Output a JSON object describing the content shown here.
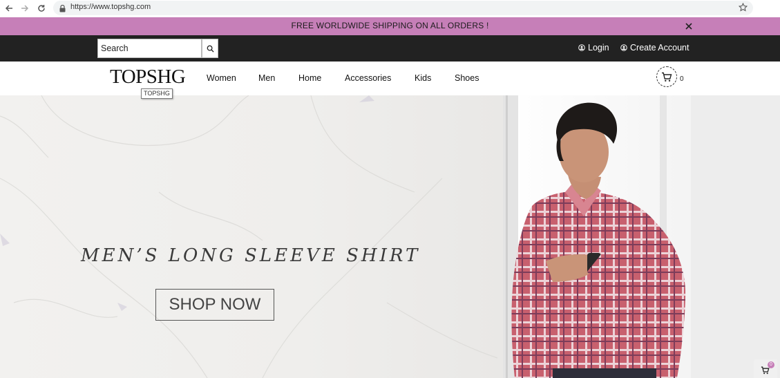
{
  "browser": {
    "url": "https://www.topshg.com",
    "back_icon": "arrow-left-icon",
    "forward_icon": "arrow-right-icon",
    "reload_icon": "reload-icon",
    "lock_icon": "lock-icon",
    "bookmark_icon": "star-icon"
  },
  "announcement": {
    "text": "FREE WORLDWIDE SHIPPING ON ALL ORDERS !",
    "close_icon": "close-icon",
    "background": "#c67fb8"
  },
  "topbar": {
    "search_placeholder": "Search",
    "search_icon": "search-icon",
    "login_label": "Login",
    "create_account_label": "Create Account",
    "background": "#222222"
  },
  "header": {
    "logo": "TOPSHG",
    "logo_tooltip": "TOPSHG",
    "nav": [
      "Women",
      "Men",
      "Home",
      "Accessories",
      "Kids",
      "Shoes"
    ],
    "cart_count": "0",
    "cart_icon": "cart-icon"
  },
  "hero": {
    "title": "MEN’S LONG SLEEVE SHIRT",
    "cta": "SHOP NOW"
  },
  "mini_cart": {
    "count": "0",
    "badge_color": "#c67fb8"
  }
}
